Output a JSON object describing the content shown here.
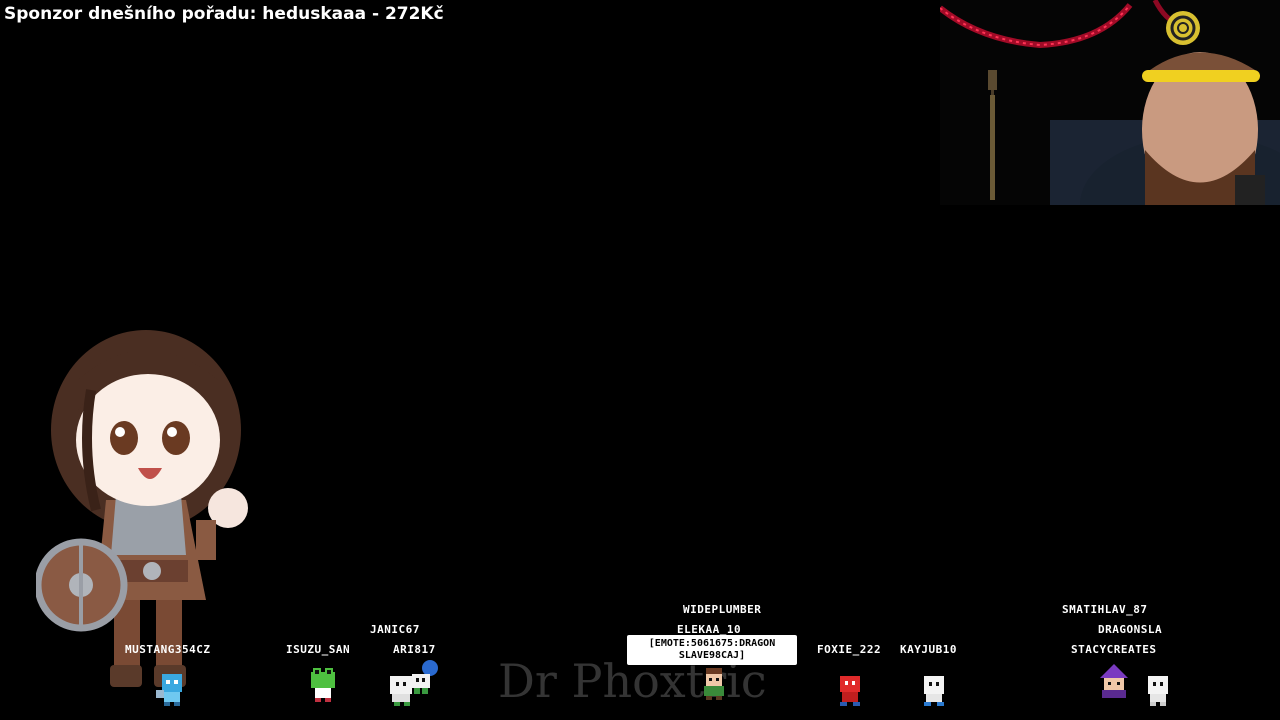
{
  "overlay": {
    "sponsor_text": "Sponzor dnešního pořadu: heduskaaa - 272Kč"
  },
  "watermark": {
    "text": "Dr Phoxtric"
  },
  "chat_bubble": {
    "line1": "[EMOTE:5061675:DRAGON",
    "line2": "SLAVE98CAJ]"
  },
  "viewers": [
    {
      "name": "MUSTANG354CZ"
    },
    {
      "name": "ISUZU_SAN"
    },
    {
      "name": "JANIC67"
    },
    {
      "name": "ARI817"
    },
    {
      "name": "WIDEPLUMBER"
    },
    {
      "name": "ELEKAA_10"
    },
    {
      "name": "FOXIE_222"
    },
    {
      "name": "KAYJUB10"
    },
    {
      "name": "SMATIHLAV_87"
    },
    {
      "name": "DRAGONSLA"
    },
    {
      "name": "STACYCREATES"
    }
  ],
  "colors": {
    "background": "#000000",
    "led": "#e0103a",
    "headband": "#f0d020"
  }
}
